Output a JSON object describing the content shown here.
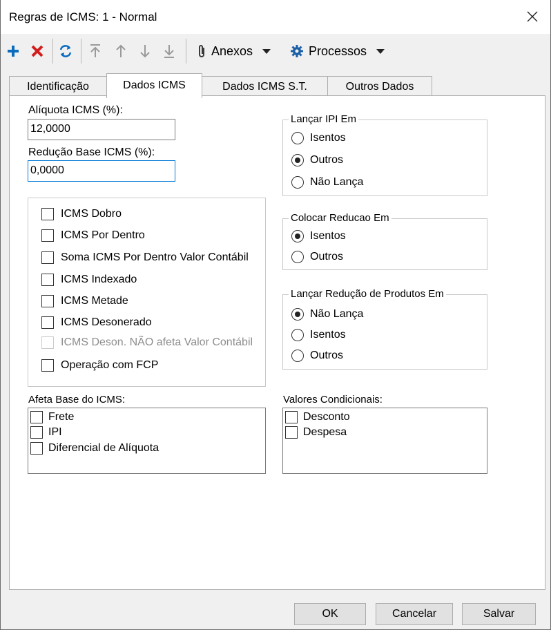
{
  "window": {
    "title": "Regras de ICMS: 1 - Normal"
  },
  "toolbar": {
    "anexos_label": "Anexos",
    "processos_label": "Processos",
    "add_color": "#0b6bbd",
    "delete_color": "#d21d1d"
  },
  "tabs": [
    {
      "label": "Identificação",
      "active": false
    },
    {
      "label": "Dados ICMS",
      "active": true
    },
    {
      "label": "Dados ICMS S.T.",
      "active": false
    },
    {
      "label": "Outros Dados",
      "active": false
    }
  ],
  "aliquota": {
    "label": "Alíquota ICMS (%):",
    "value": "12,0000"
  },
  "reducao": {
    "label": "Redução Base ICMS (%):",
    "value": "0,0000"
  },
  "options": [
    {
      "label": "ICMS Dobro",
      "checked": false,
      "enabled": true
    },
    {
      "label": "ICMS Por Dentro",
      "checked": false,
      "enabled": true
    },
    {
      "label": "Soma ICMS Por Dentro Valor Contábil",
      "checked": false,
      "enabled": true
    },
    {
      "label": "ICMS Indexado",
      "checked": false,
      "enabled": true
    },
    {
      "label": "ICMS Metade",
      "checked": false,
      "enabled": true
    },
    {
      "label": "ICMS Desonerado",
      "checked": false,
      "enabled": true
    },
    {
      "label": "ICMS Deson. NÃO afeta Valor Contábil",
      "checked": false,
      "enabled": false
    },
    {
      "label": "Operação com FCP",
      "checked": false,
      "enabled": true
    }
  ],
  "lancar_ipi": {
    "title": "Lançar IPI Em",
    "options": [
      "Isentos",
      "Outros",
      "Não Lança"
    ],
    "selected": "Outros"
  },
  "colocar_reducao": {
    "title": "Colocar Reducao Em",
    "options": [
      "Isentos",
      "Outros"
    ],
    "selected": "Isentos"
  },
  "lancar_reducao_produtos": {
    "title": "Lançar Redução de Produtos Em",
    "options": [
      "Não Lança",
      "Isentos",
      "Outros"
    ],
    "selected": "Não Lança"
  },
  "afeta_base": {
    "label": "Afeta Base do ICMS:",
    "items": [
      "Frete",
      "IPI",
      "Diferencial de Alíquota"
    ]
  },
  "valores_condicionais": {
    "label": "Valores Condicionais:",
    "items": [
      "Desconto",
      "Despesa"
    ]
  },
  "buttons": {
    "ok": "OK",
    "cancel": "Cancelar",
    "save": "Salvar"
  }
}
